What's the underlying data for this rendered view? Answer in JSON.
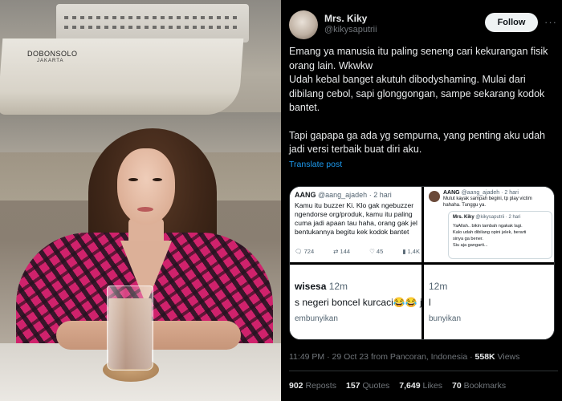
{
  "photo": {
    "ship_name": "DOBONSOLO",
    "ship_port": "JAKARTA"
  },
  "tweet": {
    "display_name": "Mrs. Kiky",
    "handle": "@kikysaputrii",
    "follow_label": "Follow",
    "more_icon": "more-horizontal-icon",
    "text_lines": [
      "Emang ya manusia itu paling seneng cari kekurangan fisik orang lain. Wkwkw",
      "Udah kebal banget akutuh dibodyshaming. Mulai dari dibilang cebol, sapi glonggongan, sampe sekarang kodok bantet.",
      "Tapi gapapa ga ada yg sempurna, yang penting aku udah jadi versi terbaik buat diri aku."
    ],
    "translate_label": "Translate post",
    "timestamp": "11:49 PM · 29 Oct 23 from Pancoran, Indonesia · ",
    "views_count": "558K",
    "views_label": " Views",
    "stats": {
      "reposts_count": "902",
      "reposts_label": "Reposts",
      "quotes_count": "157",
      "quotes_label": "Quotes",
      "likes_count": "7,649",
      "likes_label": "Likes",
      "bookmarks_count": "70",
      "bookmarks_label": "Bookmarks"
    }
  },
  "media": {
    "shot1": {
      "name": "AANG",
      "handle": " @aang_ajadeh · 2 hari",
      "lines": [
        "Kamu itu buzzer Ki. Klo gak ngebuzzer",
        "ngendorse org/produk, kamu itu paling",
        "cuma jadi apaan tau haha, orang gak jel",
        "bentukannya begitu kek kodok bantet"
      ],
      "actions": [
        "724",
        "144",
        "45",
        "1,4K"
      ]
    },
    "shot2": {
      "author": "AANG",
      "handle": " @aang_ajadeh · 2 hari",
      "text_lines": [
        "Mulut kayak sampah begini, tp play victim",
        "hahaha. Tunggu ya."
      ],
      "quoted_name": "Mrs. Kiky",
      "quoted_handle": " @kikysaputrii · 2 hari",
      "quoted_lines": [
        "YaAllah.. bikin tambah ngakak lagi.",
        "",
        "Kalo udah dibilang opini jelek, berarti",
        "sinya ga bener.",
        "Siu aja gangarti..."
      ]
    },
    "shot3": {
      "author": "wisesa",
      "time": " 12m",
      "text": "s negeri boncel kurcaci😂😂 j",
      "text2": "embunyikan"
    },
    "shot4": {
      "time": "12m",
      "text": "l",
      "text2": "bunyikan"
    }
  }
}
